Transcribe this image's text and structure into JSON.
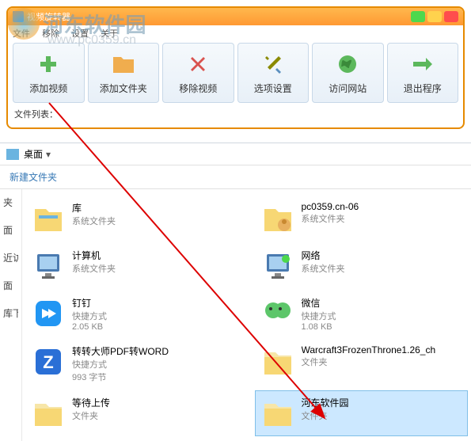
{
  "watermark": {
    "text": "河东软件园",
    "url": "www.pc0359.cn"
  },
  "app": {
    "title": "视频旋转器",
    "menu": {
      "file": "文件",
      "remove": "移除",
      "settings": "设置",
      "about": "关于"
    },
    "toolbar": {
      "add_video": "添加视频",
      "add_folder": "添加文件夹",
      "remove_video": "移除视频",
      "options": "选项设置",
      "visit_site": "访问网站",
      "exit": "退出程序"
    },
    "status_label": "文件列表："
  },
  "explorer": {
    "path": "桌面",
    "subbar": "新建文件夹",
    "sidebar": [
      "夹",
      "面",
      "近访问的位置",
      "面",
      "库下载"
    ],
    "items": [
      {
        "name": "库",
        "type": "系统文件夹",
        "size": ""
      },
      {
        "name": "pc0359.cn-06",
        "type": "系统文件夹",
        "size": ""
      },
      {
        "name": "计算机",
        "type": "系统文件夹",
        "size": ""
      },
      {
        "name": "网络",
        "type": "系统文件夹",
        "size": ""
      },
      {
        "name": "钉钉",
        "type": "快捷方式",
        "size": "2.05 KB"
      },
      {
        "name": "微信",
        "type": "快捷方式",
        "size": "1.08 KB"
      },
      {
        "name": "转转大师PDF转WORD",
        "type": "快捷方式",
        "size": "993 字节"
      },
      {
        "name": "Warcraft3FrozenThrone1.26_ch",
        "type": "文件夹",
        "size": ""
      },
      {
        "name": "等待上传",
        "type": "文件夹",
        "size": ""
      },
      {
        "name": "河东软件园",
        "type": "文件夹",
        "size": ""
      }
    ]
  }
}
